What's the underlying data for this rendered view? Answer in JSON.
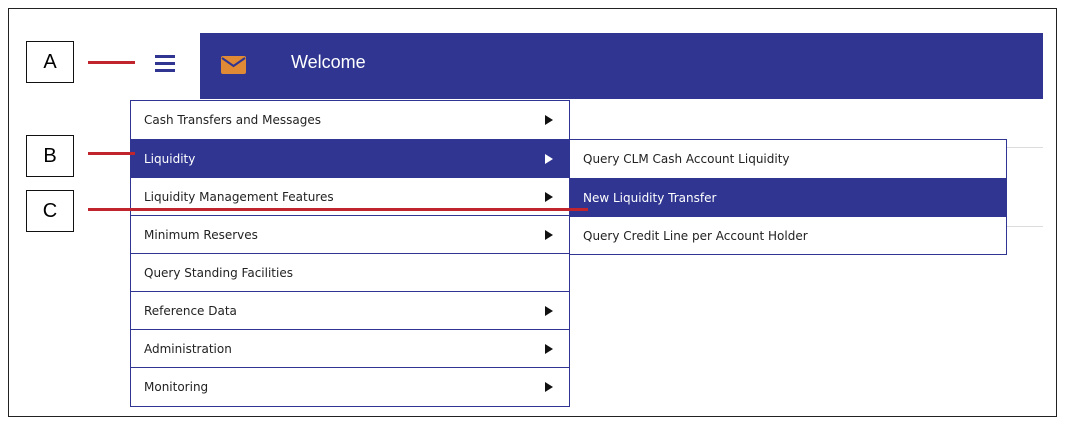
{
  "callouts": {
    "a": "A",
    "b": "B",
    "c": "C"
  },
  "header": {
    "title": "Welcome",
    "menu_icon": "hamburger-icon",
    "mail_icon": "envelope-icon"
  },
  "colors": {
    "brand": "#2f3590",
    "accent": "#e08a36",
    "leader": "#c0242c"
  },
  "main_menu": {
    "items": [
      {
        "label": "Cash Transfers and Messages",
        "has_submenu": true
      },
      {
        "label": "Liquidity",
        "has_submenu": true,
        "active": true
      },
      {
        "label": "Liquidity Management Features",
        "has_submenu": true
      },
      {
        "label": "Minimum Reserves",
        "has_submenu": true
      },
      {
        "label": "Query Standing Facilities",
        "has_submenu": false
      },
      {
        "label": "Reference Data",
        "has_submenu": true
      },
      {
        "label": "Administration",
        "has_submenu": true
      },
      {
        "label": "Monitoring",
        "has_submenu": true
      }
    ]
  },
  "submenu": {
    "items": [
      {
        "label": "Query CLM Cash Account Liquidity"
      },
      {
        "label": "New Liquidity Transfer",
        "active": true
      },
      {
        "label": "Query Credit Line per Account Holder"
      }
    ]
  }
}
